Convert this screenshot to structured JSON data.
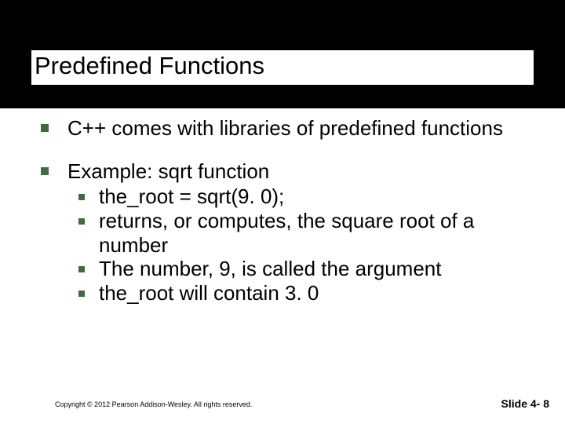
{
  "title": "Predefined Functions",
  "bullets": [
    {
      "text": "C++  comes with libraries of predefined functions",
      "subs": []
    },
    {
      "text": "Example:  sqrt function",
      "subs": [
        "the_root = sqrt(9. 0);",
        " returns, or computes, the square root of a number",
        "The number, 9, is called the argument",
        "the_root will contain 3. 0"
      ]
    }
  ],
  "footer": {
    "copyright": "Copyright © 2012 Pearson Addison-Wesley. All rights reserved.",
    "slidenum": "Slide 4- 8"
  }
}
